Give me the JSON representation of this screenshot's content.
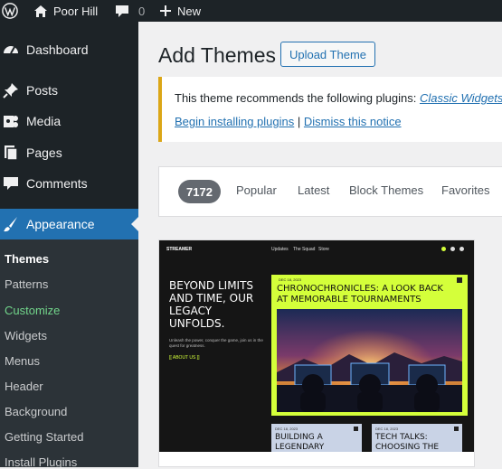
{
  "adminbar": {
    "site_name": "Poor Hill",
    "comments_count": "0",
    "new_label": "New"
  },
  "sidebar": {
    "items": [
      {
        "label": "Dashboard",
        "icon": "dashboard-icon"
      },
      {
        "label": "Posts",
        "icon": "pin-icon"
      },
      {
        "label": "Media",
        "icon": "media-icon"
      },
      {
        "label": "Pages",
        "icon": "pages-icon"
      },
      {
        "label": "Comments",
        "icon": "comment-icon"
      },
      {
        "label": "Appearance",
        "icon": "brush-icon"
      }
    ],
    "submenu": [
      "Themes",
      "Patterns",
      "Customize",
      "Widgets",
      "Menus",
      "Header",
      "Background",
      "Getting Started",
      "Install Plugins"
    ]
  },
  "main": {
    "title": "Add Themes",
    "upload_button": "Upload Theme",
    "notice": {
      "text": "This theme recommends the following plugins: ",
      "plugin_link": "Classic Widgets",
      "begin_link": "Begin installing plugins",
      "separator": "|",
      "dismiss_link": "Dismiss this notice"
    },
    "filter": {
      "count": "7172",
      "tabs": [
        "Popular",
        "Latest",
        "Block Themes",
        "Favorites"
      ]
    },
    "theme_preview": {
      "brand": "STREAMER",
      "nav": [
        "Updates",
        "The Squad",
        "Store"
      ],
      "hero_title": "BEYOND LIMITS AND TIME, OUR LEGACY UNFOLDS.",
      "hero_sub": "Unleash the power, conquer the game, join us in the quest for greatness.",
      "about_link": "[[ ABOUT US ]]",
      "feature_date": "DEC 18, 2023",
      "feature_title": "CHRONOCHRONICLES: A LOOK BACK AT MEMORABLE TOURNAMENTS",
      "card1_date": "DEC 18, 2023",
      "card1_title": "BUILDING A LEGENDARY",
      "card2_date": "DEC 18, 2023",
      "card2_title": "TECH TALKS: CHOOSING THE"
    }
  },
  "colors": {
    "admin_dark": "#1d2327",
    "accent": "#2271b1",
    "notice_border": "#dba617",
    "theme_lime": "#d4ff3a"
  }
}
